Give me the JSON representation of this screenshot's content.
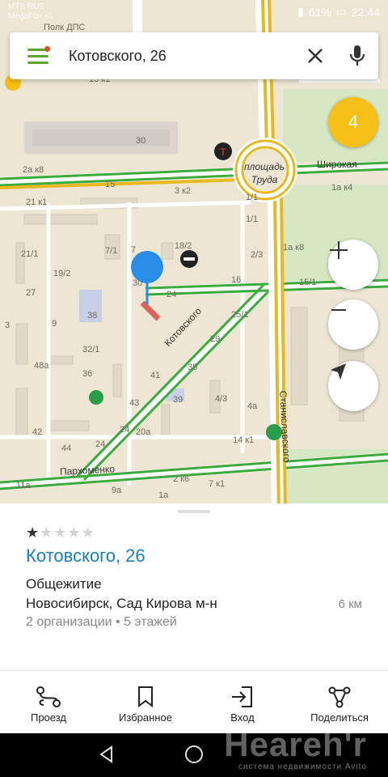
{
  "status_bar": {
    "carrier_1": "MTS RUS",
    "carrier_2": "MegaFon #1",
    "battery": "61%",
    "time": "22:44"
  },
  "search": {
    "query": "Котовского, 26"
  },
  "map": {
    "streets": {
      "shirokaya": "Широкая",
      "kotovskogo": "Котовского",
      "parkhomenko": "Пархоменко",
      "stanislavskogo": "Станиславского",
      "ploshchad": "площадь\nТруда",
      "polk_dps": "Полк ДПС"
    },
    "numbers": [
      "15 к1",
      "30",
      "2а к8",
      "15",
      "21 к1",
      "3 к2",
      "1/1",
      "1а к4",
      "1/1",
      "21/1",
      "7/1",
      "7",
      "18/2",
      "2/3",
      "1а к8",
      "19/2",
      "27",
      "30",
      "24",
      "16",
      "15/1",
      "38",
      "25/1",
      "9",
      "32/1",
      "29",
      "48а",
      "36",
      "41",
      "35",
      "43",
      "39",
      "4/3",
      "4а",
      "42",
      "24",
      "20а",
      "14 к1",
      "44",
      "24",
      "11а",
      "2 к6",
      "7 к1",
      "9а",
      "1а",
      "3"
    ],
    "cluster_count": "4"
  },
  "card": {
    "rating_filled": 1,
    "rating_total": 5,
    "title": "Котовского, 26",
    "category": "Общежитие",
    "address": "Новосибирск, Сад Кирова м-н",
    "distance": "6 км",
    "details": "2 организации • 5 этажей"
  },
  "actions": {
    "route": "Проезд",
    "favorites": "Избранное",
    "entrance": "Вход",
    "share": "Поделиться"
  },
  "watermark": {
    "brand": "Нeareh'r",
    "tagline": "система недвижимости",
    "avito": "Avito"
  },
  "colors": {
    "accent_green": "#5aa82e",
    "title_blue": "#1a7fc0",
    "cluster_yellow": "#f5bf16",
    "pin_blue": "#2a8ee8"
  }
}
